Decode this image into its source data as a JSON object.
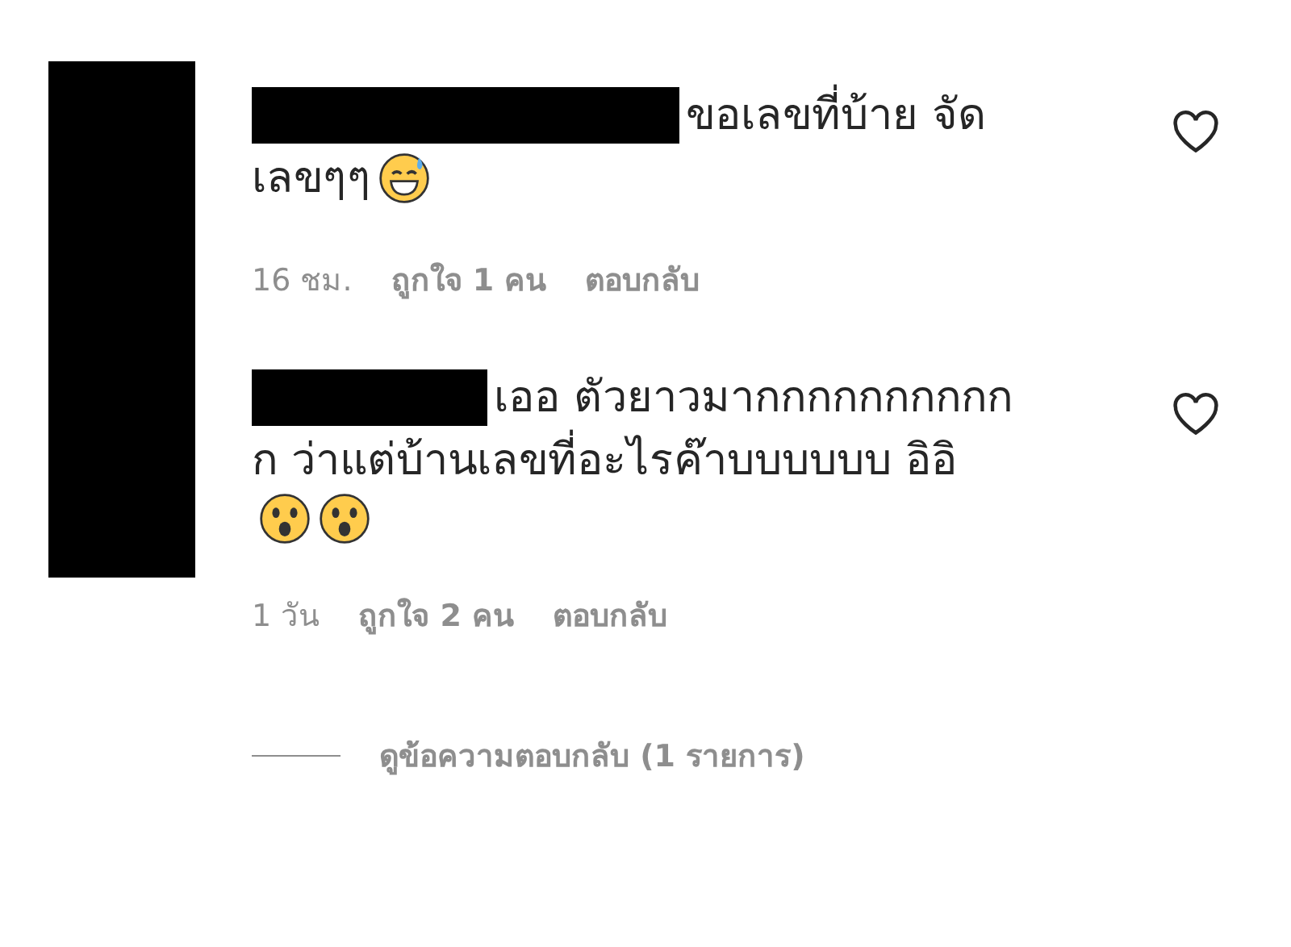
{
  "comments": [
    {
      "lines": [
        {
          "text": "ขอเลขที่บ้าย จัด"
        },
        {
          "text": "เลขๆๆ",
          "emojis": [
            {
              "kind": "sweat-smile"
            }
          ]
        }
      ],
      "liked": false,
      "time": "16 ชม.",
      "likes": "ถูกใจ 1 คน",
      "reply": "ตอบกลับ"
    },
    {
      "lines": [
        {
          "text": "เออ ตัวยาวมากกกกกกกกกก"
        },
        {
          "text": "ก ว่าแต่บ้านเลขที่อะไรค๊าบบบบบบ อิอิ"
        },
        {
          "emojis": [
            {
              "kind": "surprised"
            },
            {
              "kind": "surprised"
            }
          ]
        }
      ],
      "liked": false,
      "time": "1 วัน",
      "likes": "ถูกใจ 2 คน",
      "reply": "ตอบกลับ"
    }
  ],
  "view_replies": "ดูข้อความตอบกลับ (1 รายการ)"
}
